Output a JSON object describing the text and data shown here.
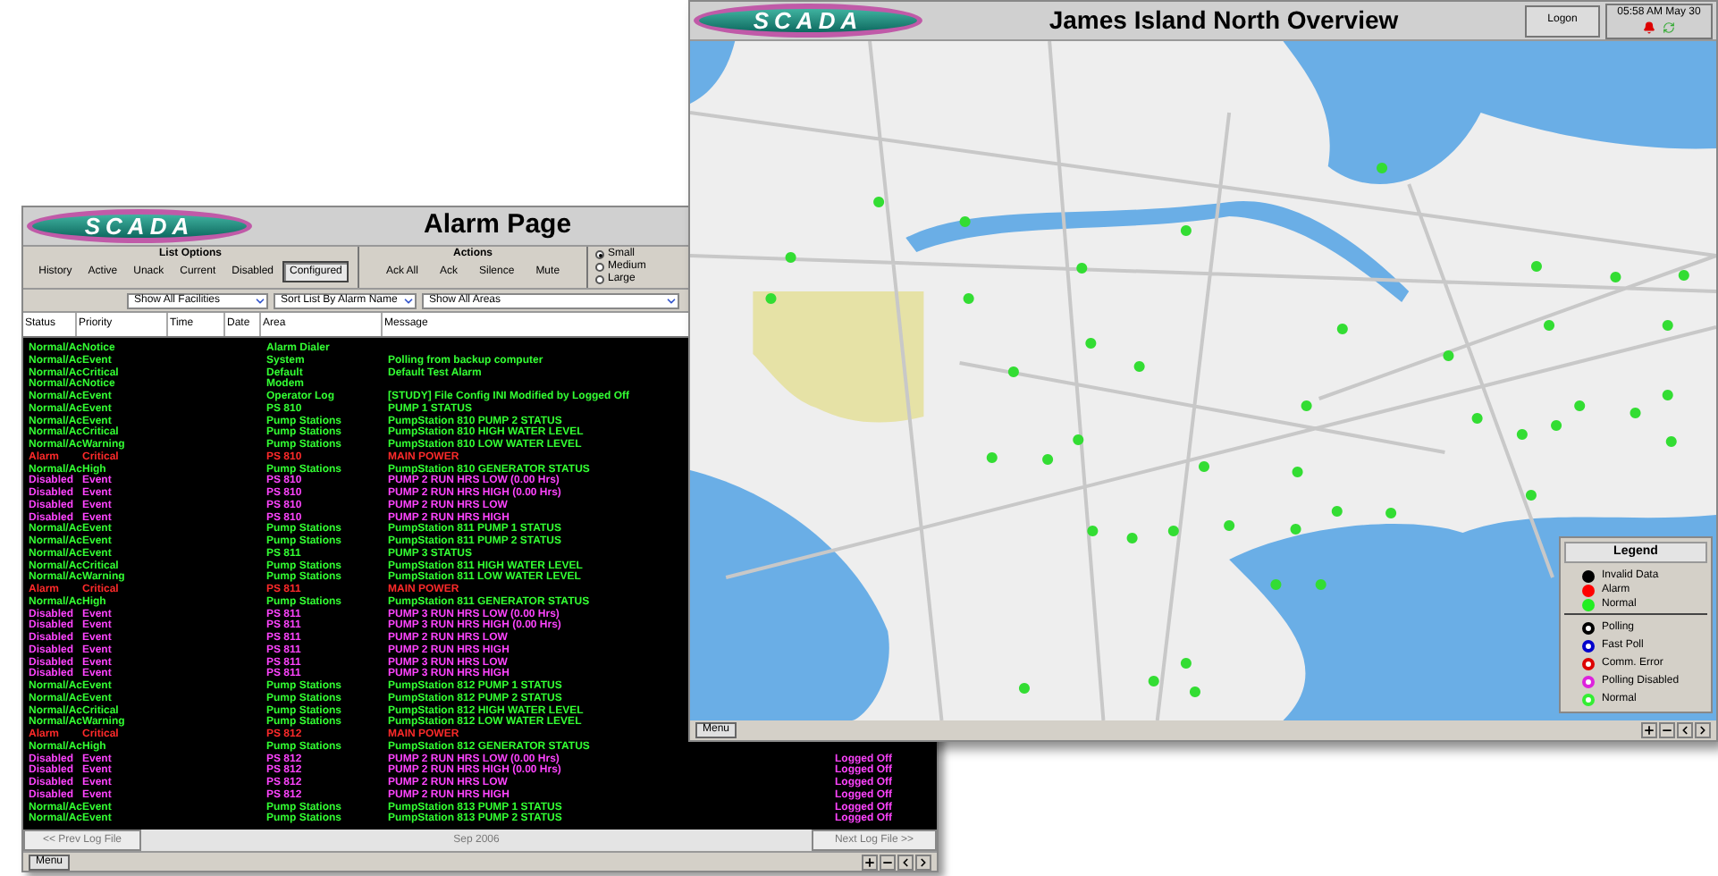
{
  "alarm_window": {
    "logo": "SCADA",
    "title": "Alarm Page",
    "list_options": {
      "label": "List Options",
      "buttons": [
        {
          "label": "History",
          "selected": false
        },
        {
          "label": "Active",
          "selected": false
        },
        {
          "label": "Unack",
          "selected": false
        },
        {
          "label": "Current",
          "selected": false
        },
        {
          "label": "Disabled",
          "selected": false
        },
        {
          "label": "Configured",
          "selected": true
        }
      ]
    },
    "actions": {
      "label": "Actions",
      "buttons": [
        "Ack All",
        "Ack",
        "Silence",
        "Mute"
      ]
    },
    "sizes": [
      {
        "label": "Small",
        "selected": true
      },
      {
        "label": "Medium",
        "selected": false
      },
      {
        "label": "Large",
        "selected": false
      }
    ],
    "filters": [
      "Show All Facilities",
      "Sort List By Alarm Name",
      "Show All Areas"
    ],
    "columns": [
      "Status",
      "Priority",
      "Time",
      "Date",
      "Area",
      "Message"
    ],
    "rows": [
      {
        "kind": "normal",
        "status": "Normal/Ac",
        "priority": "Notice",
        "area": "Alarm Dialer"
      },
      {
        "kind": "normal",
        "status": "Normal/Ac",
        "priority": "Event",
        "area": "System",
        "message": "Polling from backup computer"
      },
      {
        "kind": "normal",
        "status": "Normal/Ac",
        "priority": "Critical",
        "area": "Default",
        "message": "Default Test Alarm"
      },
      {
        "kind": "normal",
        "status": "Normal/Ac",
        "priority": "Notice",
        "area": "Modem"
      },
      {
        "kind": "normal",
        "status": "Normal/Ac",
        "priority": "Event",
        "area": "Operator Log",
        "message": "[STUDY] File Config INI Modified by Logged Off"
      },
      {
        "kind": "normal",
        "status": "Normal/Ac",
        "priority": "Event",
        "area": "PS 810",
        "message": "PUMP 1 STATUS"
      },
      {
        "kind": "normal",
        "status": "Normal/Ac",
        "priority": "Event",
        "area": "Pump Stations",
        "message": "PumpStation 810 PUMP 2 STATUS"
      },
      {
        "kind": "normal",
        "status": "Normal/Ac",
        "priority": "Critical",
        "area": "Pump Stations",
        "message": "PumpStation 810 HIGH WATER LEVEL"
      },
      {
        "kind": "normal",
        "status": "Normal/Ac",
        "priority": "Warning",
        "area": "Pump Stations",
        "message": "PumpStation 810 LOW WATER LEVEL"
      },
      {
        "kind": "alarm",
        "status": "Alarm",
        "priority": "Critical",
        "area": "PS 810",
        "message": "MAIN POWER"
      },
      {
        "kind": "normal",
        "status": "Normal/Ac",
        "priority": "High",
        "area": "Pump Stations",
        "message": "PumpStation 810 GENERATOR STATUS"
      },
      {
        "kind": "disabled",
        "status": "Disabled",
        "priority": "Event",
        "area": "PS 810",
        "message": "PUMP 2 RUN HRS LOW (0.00 Hrs)"
      },
      {
        "kind": "disabled",
        "status": "Disabled",
        "priority": "Event",
        "area": "PS 810",
        "message": "PUMP 2 RUN HRS HIGH (0.00 Hrs)"
      },
      {
        "kind": "disabled",
        "status": "Disabled",
        "priority": "Event",
        "area": "PS 810",
        "message": "PUMP 2 RUN HRS LOW"
      },
      {
        "kind": "disabled",
        "status": "Disabled",
        "priority": "Event",
        "area": "PS 810",
        "message": "PUMP 2 RUN HRS HIGH"
      },
      {
        "kind": "normal",
        "status": "Normal/Ac",
        "priority": "Event",
        "area": "Pump Stations",
        "message": "PumpStation 811 PUMP 1 STATUS"
      },
      {
        "kind": "normal",
        "status": "Normal/Ac",
        "priority": "Event",
        "area": "Pump Stations",
        "message": "PumpStation 811 PUMP 2 STATUS"
      },
      {
        "kind": "normal",
        "status": "Normal/Ac",
        "priority": "Event",
        "area": "PS 811",
        "message": "PUMP 3 STATUS"
      },
      {
        "kind": "normal",
        "status": "Normal/Ac",
        "priority": "Critical",
        "area": "Pump Stations",
        "message": "PumpStation 811 HIGH WATER LEVEL"
      },
      {
        "kind": "normal",
        "status": "Normal/Ac",
        "priority": "Warning",
        "area": "Pump Stations",
        "message": "PumpStation 811 LOW WATER LEVEL"
      },
      {
        "kind": "alarm",
        "status": "Alarm",
        "priority": "Critical",
        "area": "PS 811",
        "message": "MAIN POWER"
      },
      {
        "kind": "normal",
        "status": "Normal/Ac",
        "priority": "High",
        "area": "Pump Stations",
        "message": "PumpStation 811 GENERATOR STATUS"
      },
      {
        "kind": "disabled",
        "status": "Disabled",
        "priority": "Event",
        "area": "PS 811",
        "message": "PUMP 3 RUN HRS LOW (0.00 Hrs)"
      },
      {
        "kind": "disabled",
        "status": "Disabled",
        "priority": "Event",
        "area": "PS 811",
        "message": "PUMP 3 RUN HRS HIGH (0.00 Hrs)"
      },
      {
        "kind": "disabled",
        "status": "Disabled",
        "priority": "Event",
        "area": "PS 811",
        "message": "PUMP 2 RUN HRS LOW"
      },
      {
        "kind": "disabled",
        "status": "Disabled",
        "priority": "Event",
        "area": "PS 811",
        "message": "PUMP 2 RUN HRS HIGH"
      },
      {
        "kind": "disabled",
        "status": "Disabled",
        "priority": "Event",
        "area": "PS 811",
        "message": "PUMP 3 RUN HRS LOW"
      },
      {
        "kind": "disabled",
        "status": "Disabled",
        "priority": "Event",
        "area": "PS 811",
        "message": "PUMP 3 RUN HRS HIGH"
      },
      {
        "kind": "normal",
        "status": "Normal/Ac",
        "priority": "Event",
        "area": "Pump Stations",
        "message": "PumpStation 812 PUMP 1 STATUS"
      },
      {
        "kind": "normal",
        "status": "Normal/Ac",
        "priority": "Event",
        "area": "Pump Stations",
        "message": "PumpStation 812 PUMP 2 STATUS"
      },
      {
        "kind": "normal",
        "status": "Normal/Ac",
        "priority": "Critical",
        "area": "Pump Stations",
        "message": "PumpStation 812 HIGH WATER LEVEL"
      },
      {
        "kind": "normal",
        "status": "Normal/Ac",
        "priority": "Warning",
        "area": "Pump Stations",
        "message": "PumpStation 812 LOW WATER LEVEL"
      },
      {
        "kind": "alarm",
        "status": "Alarm",
        "priority": "Critical",
        "area": "PS 812",
        "message": "MAIN POWER"
      },
      {
        "kind": "normal",
        "status": "Normal/Ac",
        "priority": "High",
        "area": "Pump Stations",
        "message": "PumpStation 812 GENERATOR STATUS"
      },
      {
        "kind": "disabled",
        "status": "Disabled",
        "priority": "Event",
        "area": "PS 812",
        "message": "PUMP 2 RUN HRS LOW (0.00 Hrs)",
        "user": "Logged Off"
      },
      {
        "kind": "disabled",
        "status": "Disabled",
        "priority": "Event",
        "area": "PS 812",
        "message": "PUMP 2 RUN HRS HIGH (0.00 Hrs)",
        "user": "Logged Off"
      },
      {
        "kind": "disabled",
        "status": "Disabled",
        "priority": "Event",
        "area": "PS 812",
        "message": "PUMP 2 RUN HRS LOW",
        "user": "Logged Off"
      },
      {
        "kind": "disabled",
        "status": "Disabled",
        "priority": "Event",
        "area": "PS 812",
        "message": "PUMP 2 RUN HRS HIGH",
        "user": "Logged Off"
      },
      {
        "kind": "normal",
        "status": "Normal/Ac",
        "priority": "Event",
        "area": "Pump Stations",
        "message": "PumpStation 813 PUMP 1 STATUS",
        "user": "Logged Off"
      },
      {
        "kind": "normal",
        "status": "Normal/Ac",
        "priority": "Event",
        "area": "Pump Stations",
        "message": "PumpStation 813 PUMP 2 STATUS",
        "user": "Logged Off"
      }
    ],
    "prev_button": "<< Prev Log File",
    "month": "Sep 2006",
    "next_button": "Next Log File >>",
    "menu_button": "Menu"
  },
  "map_window": {
    "logo": "SCADA",
    "title": "James Island North Overview",
    "logon_button": "Logon",
    "clock": "05:58 AM May 30",
    "legend": {
      "title": "Legend",
      "items": [
        {
          "kind": "dot",
          "label": "Invalid Data",
          "color": "#000000"
        },
        {
          "kind": "dot",
          "label": "Alarm",
          "color": "#ff0000"
        },
        {
          "kind": "dot",
          "label": "Normal",
          "color": "#22ee22"
        },
        {
          "kind": "ring",
          "label": "Polling",
          "color": "#000000"
        },
        {
          "kind": "ring",
          "label": "Fast Poll",
          "color": "#0000cc"
        },
        {
          "kind": "ring",
          "label": "Comm. Error",
          "color": "#dd0000"
        },
        {
          "kind": "ring",
          "label": "Polling Disabled",
          "color": "#dd22dd"
        },
        {
          "kind": "ring",
          "label": "Normal",
          "color": "#33ee33"
        }
      ]
    },
    "menu_button": "Menu"
  }
}
